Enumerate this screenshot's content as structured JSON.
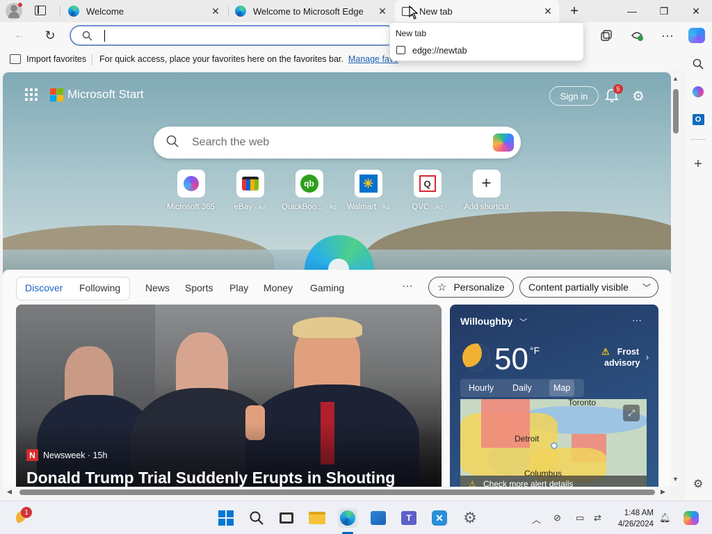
{
  "tabs": [
    {
      "title": "Welcome",
      "close": "✕"
    },
    {
      "title": "Welcome to Microsoft Edge",
      "close": "✕"
    },
    {
      "title": "New tab",
      "close": "✕"
    }
  ],
  "new_tab_button": "+",
  "window": {
    "minimize": "—",
    "restore": "❐",
    "close": "✕"
  },
  "address_bar": {
    "value": "",
    "placeholder": ""
  },
  "hover_card": {
    "title": "New tab",
    "url": "edge://newtab"
  },
  "favorites_bar": {
    "import_label": "Import favorites",
    "message": "For quick access, place your favorites here on the favorites bar.",
    "manage_link": "Manage favo"
  },
  "ntp": {
    "brand": "Microsoft Start",
    "sign_in": "Sign in",
    "notifications_count": "5",
    "search_placeholder": "Search the web",
    "tiles": [
      {
        "label": "Microsoft 365",
        "ad": "",
        "glyph": "◉",
        "color": "#7b5cf0"
      },
      {
        "label": "eBay",
        "ad": "· Ad",
        "glyph": "🛍",
        "color": "#e53238"
      },
      {
        "label": "QuickBoo...",
        "ad": "· Ad",
        "glyph": "qb",
        "color": "#2ca01c"
      },
      {
        "label": "Walmart",
        "ad": "· Ad",
        "glyph": "✳",
        "color": "#0071ce"
      },
      {
        "label": "QVC",
        "ad": "· Ad",
        "glyph": "Q",
        "color": "#d9272e"
      },
      {
        "label": "Add shortcut",
        "ad": "",
        "glyph": "+",
        "color": "#333333"
      }
    ]
  },
  "feed_nav": {
    "discover": "Discover",
    "following": "Following",
    "items": [
      "News",
      "Sports",
      "Play",
      "Money",
      "Gaming"
    ],
    "more": "···",
    "personalize": "Personalize",
    "content_visibility": "Content partially visible"
  },
  "news": {
    "source_logo": "N",
    "source": "Newsweek · 15h",
    "headline": "Donald Trump Trial Suddenly Erupts in Shouting"
  },
  "weather": {
    "location": "Willoughby",
    "temperature": "50",
    "unit": "°F",
    "alert": "Frost advisory",
    "tabs": [
      "Hourly",
      "Daily",
      "Map"
    ],
    "selected_tab": "Map",
    "map_cities": [
      "Toronto",
      "Detroit",
      "Columbus"
    ],
    "map_alert": "Check more alert details"
  },
  "taskbar": {
    "weather_badge": "1",
    "time": "1:48 AM",
    "date": "4/26/2024"
  }
}
